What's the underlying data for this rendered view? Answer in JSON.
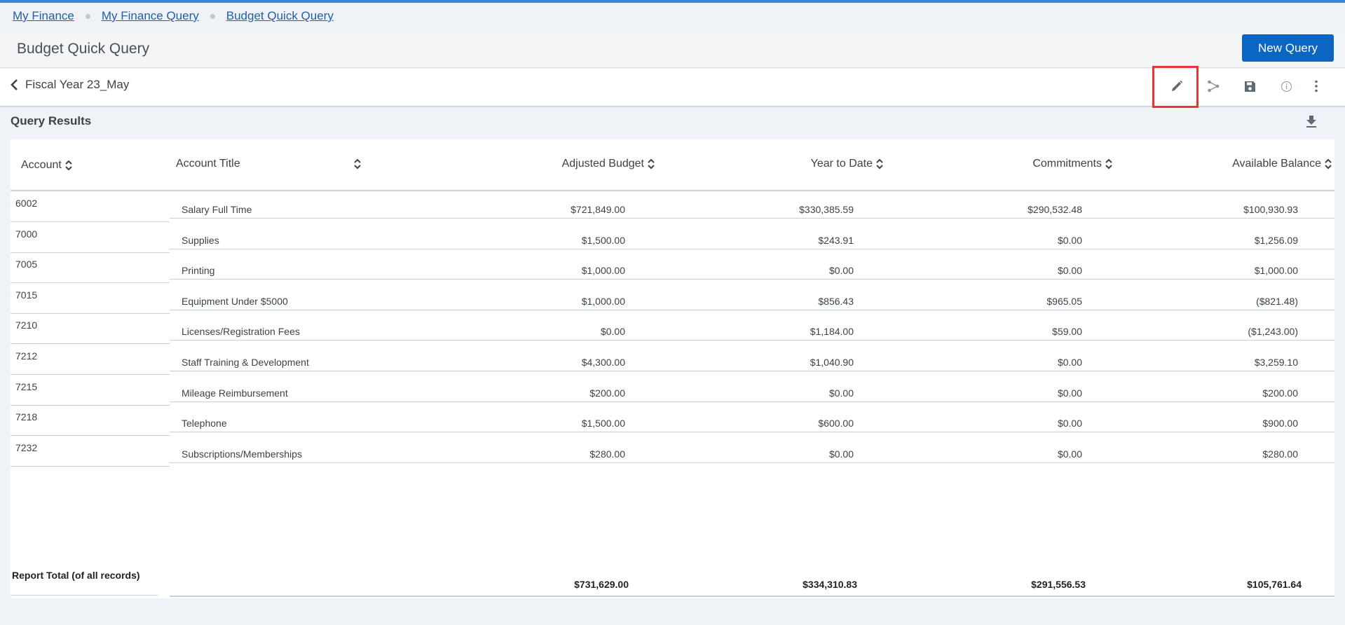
{
  "breadcrumb": [
    "My Finance",
    "My Finance Query",
    "Budget Quick Query"
  ],
  "page_title": "Budget Quick Query",
  "new_query_label": "New Query",
  "fiscal_year_label": "Fiscal Year 23_May",
  "toolbar_icons": [
    "pencil-icon",
    "share-icon",
    "save-icon",
    "info-icon",
    "more-vertical-icon"
  ],
  "results_heading": "Query Results",
  "columns": {
    "account": "Account",
    "account_title": "Account Title",
    "adjusted_budget": "Adjusted Budget",
    "year_to_date": "Year to Date",
    "commitments": "Commitments",
    "available_balance": "Available Balance"
  },
  "rows": [
    {
      "account": "6002",
      "title": "Salary Full Time",
      "adjusted_budget": "$721,849.00",
      "year_to_date": "$330,385.59",
      "commitments": "$290,532.48",
      "available_balance": "$100,930.93"
    },
    {
      "account": "7000",
      "title": "Supplies",
      "adjusted_budget": "$1,500.00",
      "year_to_date": "$243.91",
      "commitments": "$0.00",
      "available_balance": "$1,256.09"
    },
    {
      "account": "7005",
      "title": "Printing",
      "adjusted_budget": "$1,000.00",
      "year_to_date": "$0.00",
      "commitments": "$0.00",
      "available_balance": "$1,000.00"
    },
    {
      "account": "7015",
      "title": "Equipment Under $5000",
      "adjusted_budget": "$1,000.00",
      "year_to_date": "$856.43",
      "commitments": "$965.05",
      "available_balance": "($821.48)"
    },
    {
      "account": "7210",
      "title": "Licenses/Registration Fees",
      "adjusted_budget": "$0.00",
      "year_to_date": "$1,184.00",
      "commitments": "$59.00",
      "available_balance": "($1,243.00)"
    },
    {
      "account": "7212",
      "title": "Staff Training & Development",
      "adjusted_budget": "$4,300.00",
      "year_to_date": "$1,040.90",
      "commitments": "$0.00",
      "available_balance": "$3,259.10"
    },
    {
      "account": "7215",
      "title": "Mileage Reimbursement",
      "adjusted_budget": "$200.00",
      "year_to_date": "$0.00",
      "commitments": "$0.00",
      "available_balance": "$200.00"
    },
    {
      "account": "7218",
      "title": "Telephone",
      "adjusted_budget": "$1,500.00",
      "year_to_date": "$600.00",
      "commitments": "$0.00",
      "available_balance": "$900.00"
    },
    {
      "account": "7232",
      "title": "Subscriptions/Memberships",
      "adjusted_budget": "$280.00",
      "year_to_date": "$0.00",
      "commitments": "$0.00",
      "available_balance": "$280.00"
    }
  ],
  "totals": {
    "label": "Report Total (of all records)",
    "adjusted_budget": "$731,629.00",
    "year_to_date": "$334,310.83",
    "commitments": "$291,556.53",
    "available_balance": "$105,761.64"
  },
  "colors": {
    "accent": "#0a66c2",
    "highlight": "#e53535",
    "link": "#1f5fa6"
  }
}
